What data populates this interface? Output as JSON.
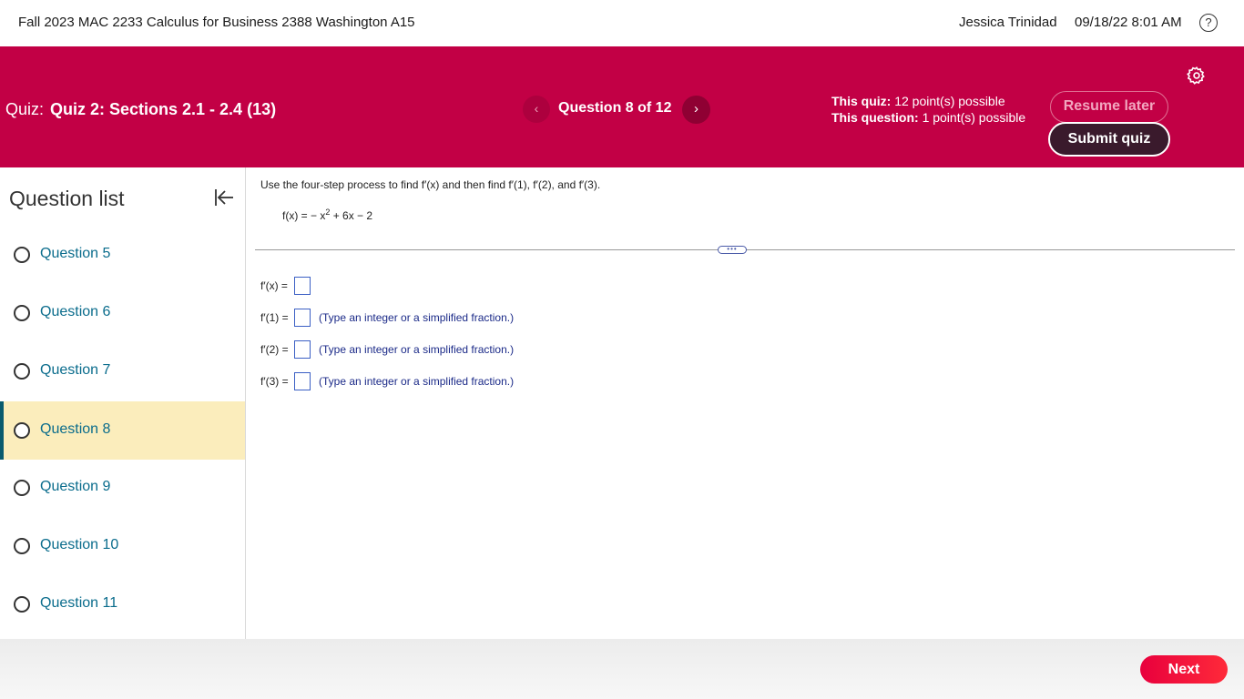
{
  "topbar": {
    "course_title": "Fall 2023 MAC 2233 Calculus for Business 2388 Washington A15",
    "user_name": "Jessica Trinidad",
    "datetime": "09/18/22 8:01 AM",
    "help_glyph": "?"
  },
  "quizbar": {
    "quiz_label": "Quiz:",
    "quiz_name": "Quiz 2: Sections 2.1 - 2.4 (13)",
    "prev_glyph": "‹",
    "question_counter": "Question 8 of 12",
    "next_glyph": "›",
    "quiz_points_label": "This quiz:",
    "quiz_points_value": "12 point(s) possible",
    "question_points_label": "This question:",
    "question_points_value": "1 point(s) possible",
    "resume_label": "Resume later",
    "submit_label": "Submit quiz"
  },
  "sidebar": {
    "title": "Question list",
    "items": [
      {
        "label": "Question 5"
      },
      {
        "label": "Question 6"
      },
      {
        "label": "Question 7"
      },
      {
        "label": "Question 8"
      },
      {
        "label": "Question 9"
      },
      {
        "label": "Question 10"
      },
      {
        "label": "Question 11"
      }
    ],
    "active_label": "Question 8"
  },
  "question": {
    "instructions": "Use the four-step process to find f′(x) and then find f′(1), f′(2), and f′(3).",
    "function_lhs": "f(x) = − x",
    "function_exp": "2",
    "function_rest": " + 6x − 2",
    "handle_glyph": "•••",
    "answers": [
      {
        "label": "f′(x) =",
        "hint": ""
      },
      {
        "label": "f′(1) =",
        "hint": "(Type an integer or a simplified fraction.)"
      },
      {
        "label": "f′(2) =",
        "hint": "(Type an integer or a simplified fraction.)"
      },
      {
        "label": "f′(3) =",
        "hint": "(Type an integer or a simplified fraction.)"
      }
    ]
  },
  "footer": {
    "next_label": "Next"
  },
  "colors": {
    "header_crimson": "#c20045",
    "link_teal": "#0a6c8c",
    "active_row": "#fbedbc",
    "next_button": "#ff2a3a"
  },
  "icons": {
    "help": "help-circle-icon",
    "settings": "gear-icon",
    "collapse": "collapse-left-icon",
    "prev": "chevron-left-icon",
    "next": "chevron-right-icon"
  }
}
